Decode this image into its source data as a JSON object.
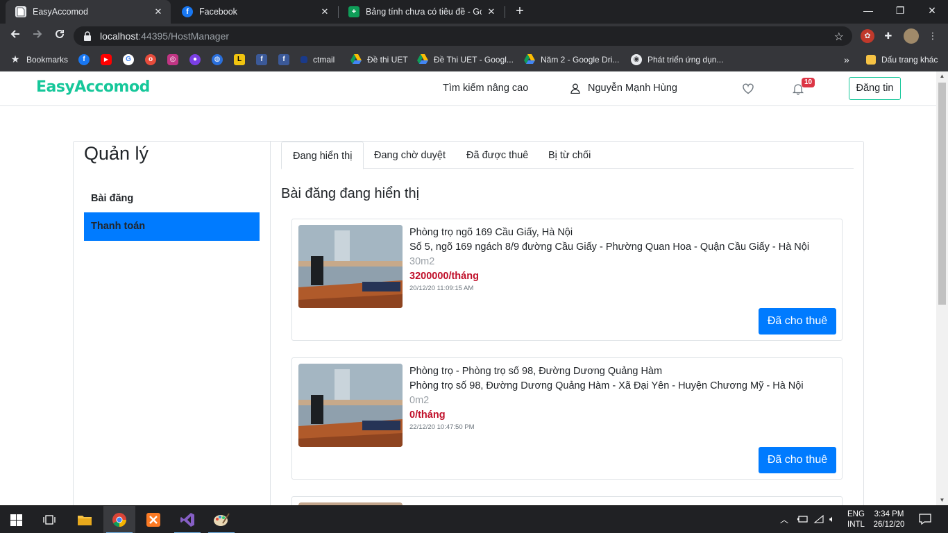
{
  "browser": {
    "tabs": [
      {
        "title": "EasyAccomod",
        "active": true
      },
      {
        "title": "Facebook",
        "active": false
      },
      {
        "title": "Bảng tính chưa có tiêu đề - Goog",
        "active": false
      }
    ],
    "url_host": "localhost",
    "url_path": ":44395/HostManager",
    "bookmarks": [
      {
        "label": "Bookmarks"
      },
      {
        "label": "ctmail"
      },
      {
        "label": "Đề thi UET"
      },
      {
        "label": "Đề Thi UET - Googl..."
      },
      {
        "label": "Năm 2 - Google Dri..."
      },
      {
        "label": "Phát triển ứng dụn..."
      },
      {
        "label": "Dấu trang khác"
      }
    ],
    "more_bookmarks": "»"
  },
  "site": {
    "logo": "EasyAccomod",
    "nav": {
      "advanced_search": "Tìm kiếm nâng cao",
      "user_name": "Nguyễn Mạnh Hùng",
      "notification_count": "10",
      "post_button": "Đăng tin"
    }
  },
  "sidebar": {
    "title": "Quản lý",
    "items": [
      {
        "label": "Bài đăng",
        "active": false
      },
      {
        "label": "Thanh toán",
        "active": true
      }
    ]
  },
  "tabs": [
    {
      "label": "Đang hiển thị",
      "active": true
    },
    {
      "label": "Đang chờ duyệt",
      "active": false
    },
    {
      "label": "Đã được thuê",
      "active": false
    },
    {
      "label": "Bị từ chối",
      "active": false
    }
  ],
  "section_title": "Bài đăng đang hiển thị",
  "listings": [
    {
      "title": "Phòng trọ ngõ 169 Cầu Giấy, Hà Nội",
      "address": "Số 5, ngõ 169 ngách 8/9 đường Cầu Giấy - Phường Quan Hoa - Quận Cầu Giấy - Hà Nội",
      "area": "30m2",
      "price": "3200000/tháng",
      "time": "20/12/20 11:09:15 AM",
      "button": "Đã cho thuê"
    },
    {
      "title": "Phòng trọ - Phòng trọ số 98, Đường Dương Quảng Hàm",
      "address": "Phòng trọ số 98, Đường Dương Quảng Hàm - Xã Đại Yên - Huyện Chương Mỹ - Hà Nội",
      "area": "0m2",
      "price": "0/tháng",
      "time": "22/12/20 10:47:50 PM",
      "button": "Đã cho thuê"
    }
  ],
  "taskbar": {
    "lang_top": "ENG",
    "lang_bottom": "INTL",
    "time": "3:34 PM",
    "date": "26/12/20"
  },
  "colors": {
    "brand": "#16c79a",
    "primary": "#007bff",
    "price": "#c0102a",
    "badge": "#dc3545"
  }
}
